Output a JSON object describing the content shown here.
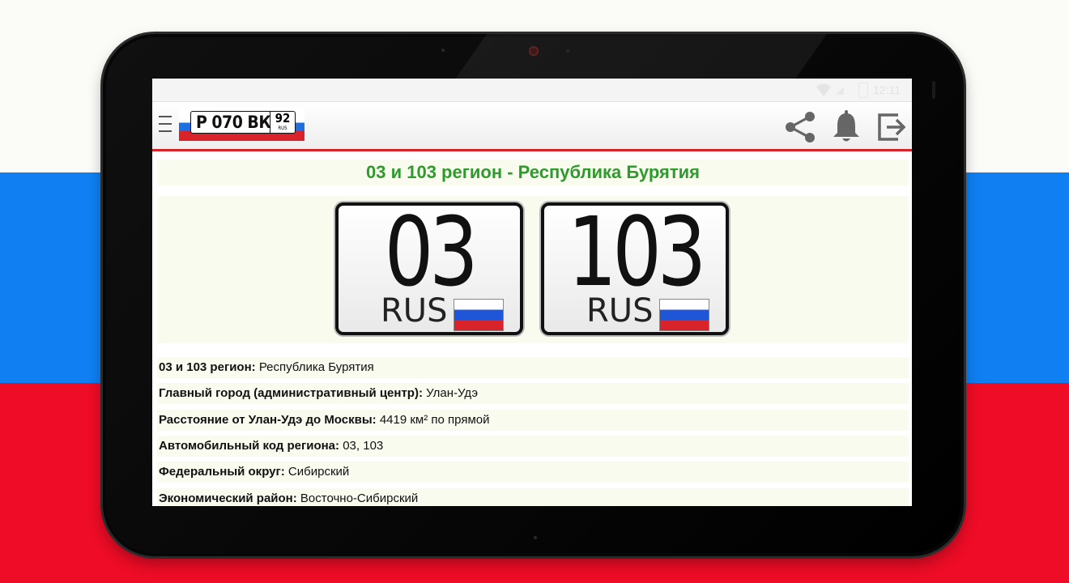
{
  "statusbar": {
    "time": "12:11"
  },
  "appbar": {
    "logo_letters": "Р 070 ВК",
    "logo_region": "92",
    "logo_rus": "RUS"
  },
  "icons": {
    "menu": "hamburger-menu-icon",
    "share": "share-icon",
    "notifications": "bell-icon",
    "exit": "exit-icon"
  },
  "page": {
    "title": "03 и 103 регион - Республика Бурятия",
    "plates": [
      {
        "code": "03",
        "country": "RUS"
      },
      {
        "code": "103",
        "country": "RUS"
      }
    ],
    "info": [
      {
        "label": "03 и 103 регион:",
        "value": "Республика Бурятия"
      },
      {
        "label": "Главный город (административный центр):",
        "value": "Улан-Удэ"
      },
      {
        "label": "Расстояние от Улан-Удэ до Москвы:",
        "value": "4419 км² по прямой"
      },
      {
        "label": "Автомобильный код региона:",
        "value": "03, 103"
      },
      {
        "label": "Федеральный округ:",
        "value": "Сибирский"
      },
      {
        "label": "Экономический район:",
        "value": "Восточно-Сибирский"
      }
    ]
  },
  "colors": {
    "title_green": "#2f9a2e",
    "appbar_accent": "#d8232a",
    "row_background": "#f9fbef"
  }
}
